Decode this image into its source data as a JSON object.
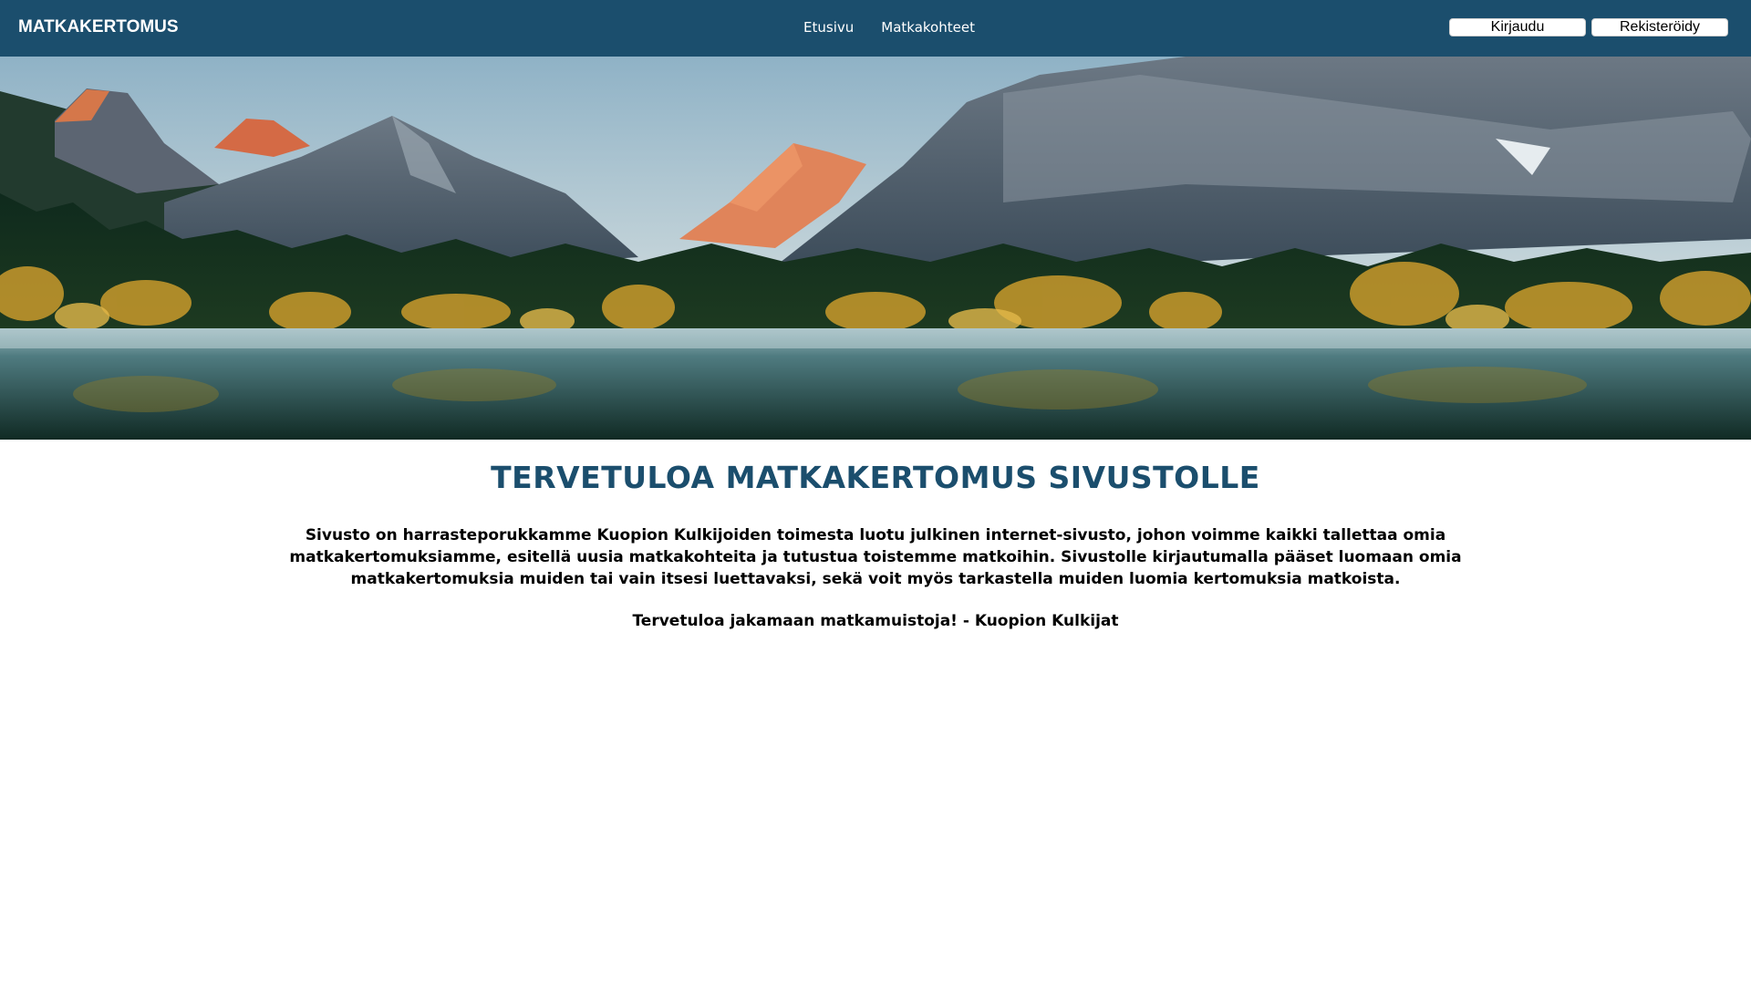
{
  "header": {
    "brand": "MATKAKERTOMUS",
    "nav": [
      "Etusivu",
      "Matkakohteet"
    ],
    "login_label": "Kirjaudu",
    "register_label": "Rekisteröidy",
    "color": "#1b4e6d"
  },
  "hero": {
    "image": "mountain-lake-forest-landscape"
  },
  "main": {
    "title": "TERVETULOA MATKAKERTOMUS SIVUSTOLLE",
    "intro": "Sivusto on harrasteporukkamme Kuopion Kulkijoiden toimesta luotu julkinen internet-sivusto, johon voimme kaikki tallettaa omia matkakertomuksiamme, esitellä uusia matkakohteita ja tutustua toistemme matkoihin. Sivustolle kirjautumalla pääset luomaan omia matkakertomuksia muiden tai vain itsesi luettavaksi, sekä voit myös tarkastella muiden luomia kertomuksia matkoista.",
    "signature": "Tervetuloa jakamaan matkamuistoja! - Kuopion Kulkijat"
  }
}
